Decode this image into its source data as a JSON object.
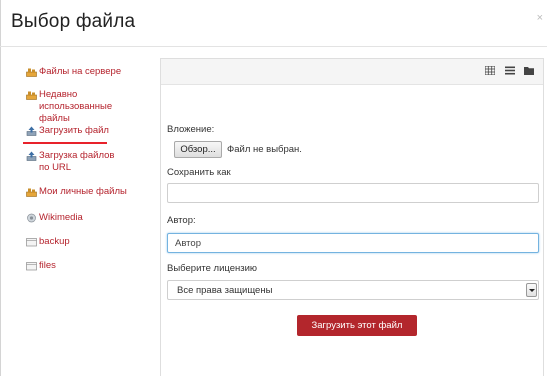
{
  "dialog": {
    "title": "Выбор файла",
    "close_glyph": "×"
  },
  "repositories": [
    {
      "label": "Файлы на сервере",
      "icon": "server-files-icon"
    },
    {
      "label": "Недавно использованные файлы",
      "icon": "recent-files-icon"
    },
    {
      "label": "Загрузить файл",
      "icon": "upload-file-icon",
      "active": true
    },
    {
      "label": "Загрузка файлов по URL",
      "icon": "url-download-icon"
    },
    {
      "label": "Мои личные файлы",
      "icon": "private-files-icon"
    },
    {
      "label": "Wikimedia",
      "icon": "wikimedia-icon"
    },
    {
      "label": "backup",
      "icon": "folder-icon"
    },
    {
      "label": "files",
      "icon": "folder-icon"
    }
  ],
  "toolbar": {
    "views": [
      "icons-view-icon",
      "list-view-icon",
      "tree-view-icon"
    ]
  },
  "upload_form": {
    "attachment_label": "Вложение:",
    "browse_label": "Обзор...",
    "no_file_text": "Файл не выбран.",
    "save_as_label": "Сохранить как",
    "save_as_value": "",
    "author_label": "Автор:",
    "author_value": "Автор",
    "license_label": "Выберите лицензию",
    "license_value": "Все права защищены",
    "submit_label": "Загрузить этот файл"
  },
  "colors": {
    "accent": "#b3262c",
    "link": "#b5242e",
    "active_underline": "#e8222b"
  }
}
